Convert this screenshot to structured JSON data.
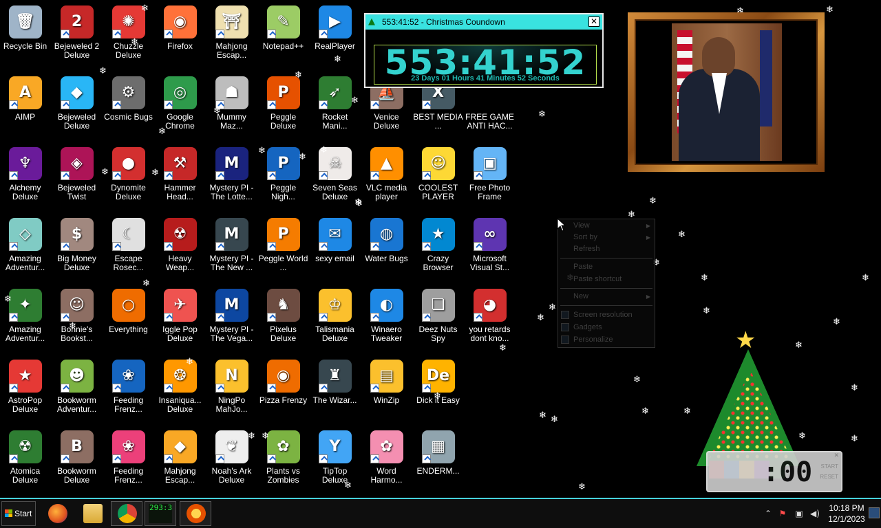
{
  "desktop": {
    "icons": [
      {
        "label": "Recycle Bin",
        "icon": "recycle-bin-icon",
        "color": "#9fb4c8",
        "glyph": "🗑",
        "shortcut": false
      },
      {
        "label": "Bejeweled 2 Deluxe",
        "icon": "bejeweled-2-icon",
        "color": "#c62828",
        "glyph": "2",
        "shortcut": true
      },
      {
        "label": "Chuzzle Deluxe",
        "icon": "chuzzle-icon",
        "color": "#e53935",
        "glyph": "✺",
        "shortcut": true
      },
      {
        "label": "Firefox",
        "icon": "firefox-icon",
        "color": "#ff7139",
        "glyph": "◉",
        "shortcut": true
      },
      {
        "label": "Mahjong Escap...",
        "icon": "mahjong-icon",
        "color": "#efe0b0",
        "glyph": "⛩",
        "shortcut": true
      },
      {
        "label": "Notepad++",
        "icon": "notepad-plus-plus-icon",
        "color": "#9ccc65",
        "glyph": "✎",
        "shortcut": true
      },
      {
        "label": "RealPlayer",
        "icon": "realplayer-icon",
        "color": "#1e88e5",
        "glyph": "▶",
        "shortcut": true
      },
      {
        "label": "AIMP",
        "icon": "aimp-icon",
        "color": "#f9a825",
        "glyph": "A",
        "shortcut": true
      },
      {
        "label": "Bejeweled Deluxe",
        "icon": "bejeweled-icon",
        "color": "#29b6f6",
        "glyph": "◆",
        "shortcut": true
      },
      {
        "label": "Cosmic Bugs",
        "icon": "cosmic-bugs-icon",
        "color": "#6d6d6d",
        "glyph": "⚙",
        "shortcut": true
      },
      {
        "label": "Google Chrome",
        "icon": "chrome-icon",
        "color": "#2e9b4b",
        "glyph": "◎",
        "shortcut": true
      },
      {
        "label": "Mummy Maz...",
        "icon": "mummy-maze-icon",
        "color": "#bdbdbd",
        "glyph": "☗",
        "shortcut": true
      },
      {
        "label": "Peggle Deluxe",
        "icon": "peggle-icon",
        "color": "#e65100",
        "glyph": "P",
        "shortcut": true
      },
      {
        "label": "Rocket Mani...",
        "icon": "rocket-mania-icon",
        "color": "#2e7d32",
        "glyph": "➶",
        "shortcut": true
      },
      {
        "label": "Venice Deluxe",
        "icon": "venice-icon",
        "color": "#8d6e63",
        "glyph": "⛵",
        "shortcut": true
      },
      {
        "label": "BEST MEDIA ...",
        "icon": "xim-player-icon",
        "color": "#455a64",
        "glyph": "X",
        "shortcut": true
      },
      {
        "label": "FREE GAME ANTI HAC...",
        "icon": "blank-file-icon",
        "color": "#000000",
        "glyph": "",
        "shortcut": false
      },
      {
        "label": "Alchemy Deluxe",
        "icon": "alchemy-icon",
        "color": "#6a1b9a",
        "glyph": "♆",
        "shortcut": true
      },
      {
        "label": "Bejeweled Twist",
        "icon": "bejeweled-twist-icon",
        "color": "#ad1457",
        "glyph": "◈",
        "shortcut": true
      },
      {
        "label": "Dynomite Deluxe",
        "icon": "dynomite-icon",
        "color": "#d32f2f",
        "glyph": "●",
        "shortcut": true
      },
      {
        "label": "Hammer Head...",
        "icon": "hammer-heads-icon",
        "color": "#c62828",
        "glyph": "⚒",
        "shortcut": true
      },
      {
        "label": "Mystery PI - The Lotte...",
        "icon": "mystery-pi-icon",
        "color": "#1a237e",
        "glyph": "M",
        "shortcut": true
      },
      {
        "label": "Peggle Nigh...",
        "icon": "peggle-nights-icon",
        "color": "#1565c0",
        "glyph": "P",
        "shortcut": true
      },
      {
        "label": "Seven Seas Deluxe",
        "icon": "seven-seas-icon",
        "color": "#efebe9",
        "glyph": "☠",
        "shortcut": true
      },
      {
        "label": "VLC media player",
        "icon": "vlc-icon",
        "color": "#ff8f00",
        "glyph": "▲",
        "shortcut": true
      },
      {
        "label": "COOLEST PLAYER",
        "icon": "coolest-player-icon",
        "color": "#fdd835",
        "glyph": "☺",
        "shortcut": true
      },
      {
        "label": "Free Photo Frame",
        "icon": "free-photo-frame-icon",
        "color": "#64b5f6",
        "glyph": "▣",
        "shortcut": true
      },
      {
        "label": "Amazing Adventur...",
        "icon": "amazing-adventures-icon",
        "color": "#80cbc4",
        "glyph": "◇",
        "shortcut": true
      },
      {
        "label": "Big Money Deluxe",
        "icon": "big-money-icon",
        "color": "#a1887f",
        "glyph": "$",
        "shortcut": true
      },
      {
        "label": "Escape Rosec...",
        "icon": "escape-rosecliff-icon",
        "color": "#e0e0e0",
        "glyph": "☾",
        "shortcut": true
      },
      {
        "label": "Heavy Weap...",
        "icon": "heavy-weapon-icon",
        "color": "#b71c1c",
        "glyph": "☢",
        "shortcut": true
      },
      {
        "label": "Mystery PI - The New ...",
        "icon": "mystery-pi-new-york-icon",
        "color": "#37474f",
        "glyph": "M",
        "shortcut": true
      },
      {
        "label": "Peggle World ...",
        "icon": "peggle-world-icon",
        "color": "#f57c00",
        "glyph": "P",
        "shortcut": true
      },
      {
        "label": "sexy email",
        "icon": "thunderbird-icon",
        "color": "#1e88e5",
        "glyph": "✉",
        "shortcut": true
      },
      {
        "label": "Water Bugs",
        "icon": "water-bugs-icon",
        "color": "#1976d2",
        "glyph": "◍",
        "shortcut": true
      },
      {
        "label": "Crazy Browser",
        "icon": "crazy-browser-icon",
        "color": "#0288d1",
        "glyph": "★",
        "shortcut": true
      },
      {
        "label": "Microsoft Visual St...",
        "icon": "visual-studio-icon",
        "color": "#5e35b1",
        "glyph": "∞",
        "shortcut": true
      },
      {
        "label": "Amazing Adventur...",
        "icon": "amazing-adventures-2-icon",
        "color": "#2e7d32",
        "glyph": "✦",
        "shortcut": true
      },
      {
        "label": "Bonnie's Bookst...",
        "icon": "bonnies-bookstore-icon",
        "color": "#8d6e63",
        "glyph": "☺",
        "shortcut": true
      },
      {
        "label": "Everything",
        "icon": "everything-search-icon",
        "color": "#ef6c00",
        "glyph": "○",
        "shortcut": false
      },
      {
        "label": "Iggle Pop Deluxe",
        "icon": "iggle-pop-icon",
        "color": "#ef5350",
        "glyph": "✈",
        "shortcut": true
      },
      {
        "label": "Mystery PI - The Vega...",
        "icon": "mystery-pi-vegas-icon",
        "color": "#0d47a1",
        "glyph": "M",
        "shortcut": true
      },
      {
        "label": "Pixelus Deluxe",
        "icon": "pixelus-icon",
        "color": "#6d4c41",
        "glyph": "♞",
        "shortcut": true
      },
      {
        "label": "Talismania Deluxe",
        "icon": "talismania-icon",
        "color": "#fbc02d",
        "glyph": "♔",
        "shortcut": true
      },
      {
        "label": "Winaero Tweaker",
        "icon": "winaero-tweaker-icon",
        "color": "#1e88e5",
        "glyph": "◐",
        "shortcut": true
      },
      {
        "label": "Deez Nuts Spy",
        "icon": "deez-nuts-spy-icon",
        "color": "#9e9e9e",
        "glyph": "❏",
        "shortcut": true
      },
      {
        "label": "you retards dont kno...",
        "icon": "red-logo-icon",
        "color": "#d32f2f",
        "glyph": "◕",
        "shortcut": true
      },
      {
        "label": "AstroPop Deluxe",
        "icon": "astropop-icon",
        "color": "#e53935",
        "glyph": "★",
        "shortcut": true
      },
      {
        "label": "Bookworm Adventur...",
        "icon": "bookworm-adventures-icon",
        "color": "#7cb342",
        "glyph": "☻",
        "shortcut": true
      },
      {
        "label": "Feeding Frenz...",
        "icon": "feeding-frenzy-icon",
        "color": "#1565c0",
        "glyph": "❀",
        "shortcut": true
      },
      {
        "label": "Insaniqua... Deluxe",
        "icon": "insaniquarium-icon",
        "color": "#ff9800",
        "glyph": "❂",
        "shortcut": true
      },
      {
        "label": "NingPo MahJo...",
        "icon": "ningpo-mahjong-icon",
        "color": "#fbc02d",
        "glyph": "N",
        "shortcut": true
      },
      {
        "label": "Pizza Frenzy",
        "icon": "pizza-frenzy-icon",
        "color": "#ef6c00",
        "glyph": "◉",
        "shortcut": true
      },
      {
        "label": "The Wizar...",
        "icon": "the-wizards-pen-icon",
        "color": "#37474f",
        "glyph": "♜",
        "shortcut": true
      },
      {
        "label": "WinZip",
        "icon": "winzip-icon",
        "color": "#fbc02d",
        "glyph": "▤",
        "shortcut": true
      },
      {
        "label": "Dick it Easy",
        "icon": "dick-it-easy-icon",
        "color": "#ffb300",
        "glyph": "De",
        "shortcut": true
      },
      {
        "label": "Atomica Deluxe",
        "icon": "atomica-icon",
        "color": "#2e7d32",
        "glyph": "☢",
        "shortcut": true
      },
      {
        "label": "Bookworm Deluxe",
        "icon": "bookworm-deluxe-icon",
        "color": "#8d6e63",
        "glyph": "B",
        "shortcut": true
      },
      {
        "label": "Feeding Frenz...",
        "icon": "feeding-frenzy-2-icon",
        "color": "#ec407a",
        "glyph": "❀",
        "shortcut": true
      },
      {
        "label": "Mahjong Escap...",
        "icon": "mahjong-escape-icon",
        "color": "#f9a825",
        "glyph": "◆",
        "shortcut": true
      },
      {
        "label": "Noah's Ark Deluxe",
        "icon": "noahs-ark-icon",
        "color": "#eeeeee",
        "glyph": "❦",
        "shortcut": true
      },
      {
        "label": "Plants vs Zombies",
        "icon": "plants-vs-zombies-icon",
        "color": "#7cb342",
        "glyph": "✿",
        "shortcut": true
      },
      {
        "label": "TipTop Deluxe",
        "icon": "tiptop-icon",
        "color": "#42a5f5",
        "glyph": "Y",
        "shortcut": true
      },
      {
        "label": "Word Harmo...",
        "icon": "word-harmony-icon",
        "color": "#f48fb1",
        "glyph": "✿",
        "shortcut": true
      },
      {
        "label": "ENDERM...",
        "icon": "enderman-icon",
        "color": "#90a4ae",
        "glyph": "▦",
        "shortcut": true
      }
    ]
  },
  "countdown": {
    "title": "553:41:52 - Christmas Coundown",
    "big": "553:41:52",
    "sub": "23 Days 01 Hours 41 Minutes 52 Seconds",
    "close": "✕",
    "accent": "#39e2e0"
  },
  "context_menu": {
    "items": [
      "View",
      "Sort by",
      "Refresh",
      "Paste",
      "Paste shortcut",
      "New",
      "Screen resolution",
      "Gadgets",
      "Personalize"
    ]
  },
  "clock_gadget": {
    "digits": ":00",
    "start": "START",
    "reset": "RESET"
  },
  "taskbar": {
    "start_label": "Start",
    "countdown_badge": "293:3",
    "time": "10:18 PM",
    "date": "12/1/2023",
    "accent": "#46d3dc"
  }
}
